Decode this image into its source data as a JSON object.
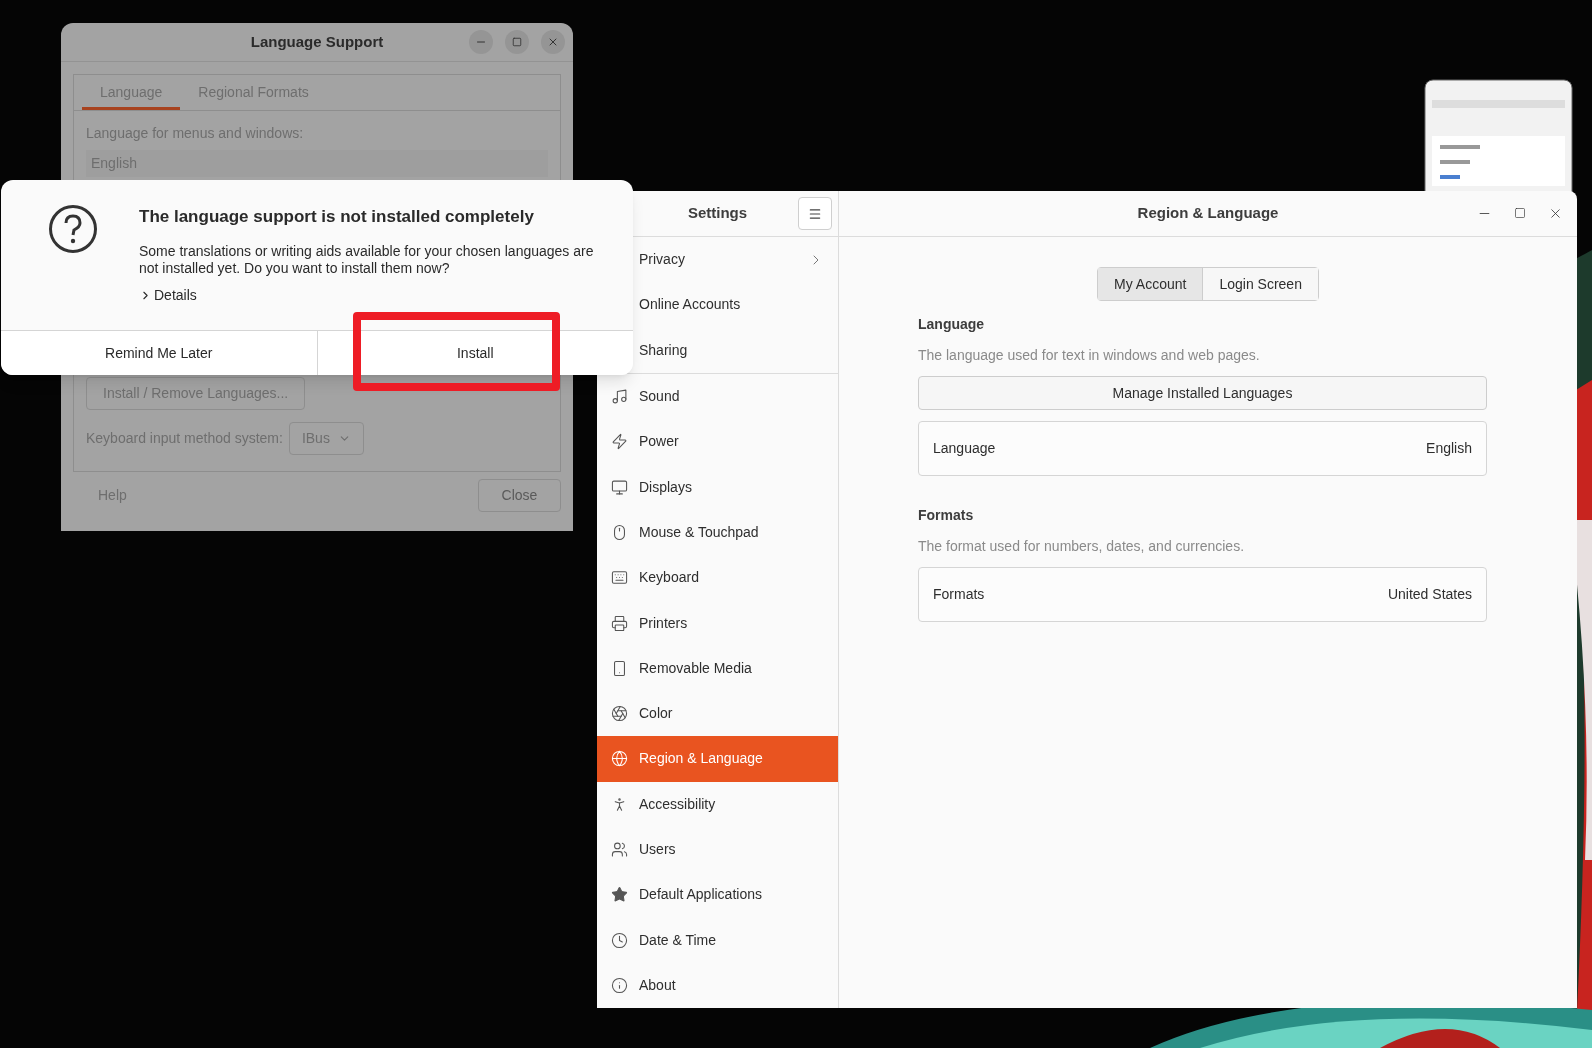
{
  "language_support": {
    "title": "Language Support",
    "tabs": [
      {
        "label": "Language",
        "selected": true
      },
      {
        "label": "Regional Formats",
        "selected": false
      }
    ],
    "list_label": "Language for menus and windows:",
    "languages": [
      "English"
    ],
    "install_remove_button": "Install / Remove Languages...",
    "input_method_label": "Keyboard input method system:",
    "input_method_value": "IBus",
    "help_button": "Help",
    "close_button": "Close"
  },
  "dialog": {
    "title": "The language support is not installed completely",
    "message": "Some translations or writing aids available for your chosen languages are not installed yet. Do you want to install them now?",
    "details": "Details",
    "buttons": [
      {
        "label": "Remind Me Later",
        "highlighted": false
      },
      {
        "label": "Install",
        "highlighted": true
      }
    ]
  },
  "settings": {
    "sidebar_title": "Settings",
    "title": "Region & Language",
    "sidebar_groups": [
      [
        {
          "label": "Privacy",
          "selected": false,
          "submenu": true
        },
        {
          "label": "Online Accounts",
          "selected": false,
          "submenu": false
        },
        {
          "label": "Sharing",
          "selected": false,
          "submenu": false
        }
      ],
      [
        {
          "label": "Sound",
          "selected": false,
          "submenu": false
        },
        {
          "label": "Power",
          "selected": false,
          "submenu": false
        },
        {
          "label": "Displays",
          "selected": false,
          "submenu": false
        },
        {
          "label": "Mouse & Touchpad",
          "selected": false,
          "submenu": false
        },
        {
          "label": "Keyboard",
          "selected": false,
          "submenu": false
        },
        {
          "label": "Printers",
          "selected": false,
          "submenu": false
        },
        {
          "label": "Removable Media",
          "selected": false,
          "submenu": false
        },
        {
          "label": "Color",
          "selected": false,
          "submenu": false
        },
        {
          "label": "Region & Language",
          "selected": true,
          "submenu": false
        },
        {
          "label": "Accessibility",
          "selected": false,
          "submenu": false
        },
        {
          "label": "Users",
          "selected": false,
          "submenu": false
        },
        {
          "label": "Default Applications",
          "selected": false,
          "submenu": false
        },
        {
          "label": "Date & Time",
          "selected": false,
          "submenu": false
        },
        {
          "label": "About",
          "selected": false,
          "submenu": false
        }
      ]
    ],
    "tabs": [
      {
        "label": "My Account",
        "selected": true
      },
      {
        "label": "Login Screen",
        "selected": false
      }
    ],
    "sections": [
      {
        "heading": "Language",
        "description": "The language used for text in windows and web pages.",
        "button": "Manage Installed Languages",
        "rows": [
          {
            "label": "Language",
            "value": "English"
          }
        ]
      },
      {
        "heading": "Formats",
        "description": "The format used for numbers, dates, and currencies.",
        "rows": [
          {
            "label": "Formats",
            "value": "United States"
          }
        ]
      }
    ]
  }
}
